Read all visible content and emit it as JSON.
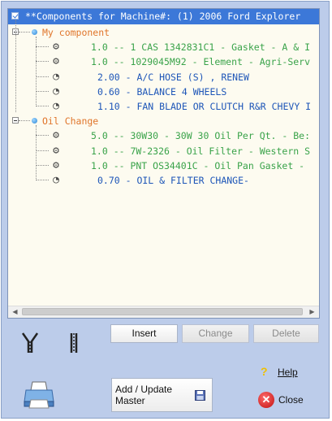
{
  "tree": {
    "header_text": "**Components for Machine#: (1) 2006 Ford Explorer",
    "groups": [
      {
        "label": "My component",
        "items": [
          {
            "text": "1.0 -- 1 CAS 1342831C1 - Gasket - A & I",
            "color": "green",
            "icon": "gear-icon"
          },
          {
            "text": "1.0 -- 1029045M92 - Element - Agri-Serv",
            "color": "green",
            "icon": "gear-icon"
          },
          {
            "text": "2.00 - A/C HOSE (S) , RENEW",
            "color": "blue",
            "icon": "wrench-icon"
          },
          {
            "text": "0.60 - BALANCE 4 WHEELS",
            "color": "blue",
            "icon": "wrench-icon"
          },
          {
            "text": "1.10 - FAN BLADE OR CLUTCH R&R CHEVY I",
            "color": "blue",
            "icon": "wrench-icon"
          }
        ]
      },
      {
        "label": "Oil Change",
        "items": [
          {
            "text": "5.0 -- 30W30 - 30W 30 Oil Per Qt. - Be:",
            "color": "green",
            "icon": "gear-icon"
          },
          {
            "text": "1.0 -- 7W-2326 - Oil Filter - Western S",
            "color": "green",
            "icon": "gear-icon"
          },
          {
            "text": "1.0 -- PNT OS34401C - Oil Pan Gasket -",
            "color": "green",
            "icon": "gear-icon"
          },
          {
            "text": "0.70 - OIL & FILTER CHANGE-",
            "color": "blue",
            "icon": "wrench-icon"
          }
        ]
      }
    ],
    "colors": {
      "header_bg": "#3c78d8",
      "group_text": "#e0752a",
      "part_text": "#3aa34a",
      "labor_text": "#1e56b8",
      "tree_bg": "#fdfbf0",
      "window_bg": "#bcccea"
    }
  },
  "buttons": {
    "insert": "Insert",
    "change": "Change",
    "delete": "Delete",
    "add_update_master": "Add / Update Master",
    "help": "Help",
    "close": "Close"
  },
  "icons": {
    "expand_all": "zipper-open-icon",
    "collapse_all": "zipper-closed-icon",
    "print": "printer-icon",
    "save": "floppy-disk-icon",
    "help": "question-mark-icon",
    "close": "close-x-icon"
  }
}
